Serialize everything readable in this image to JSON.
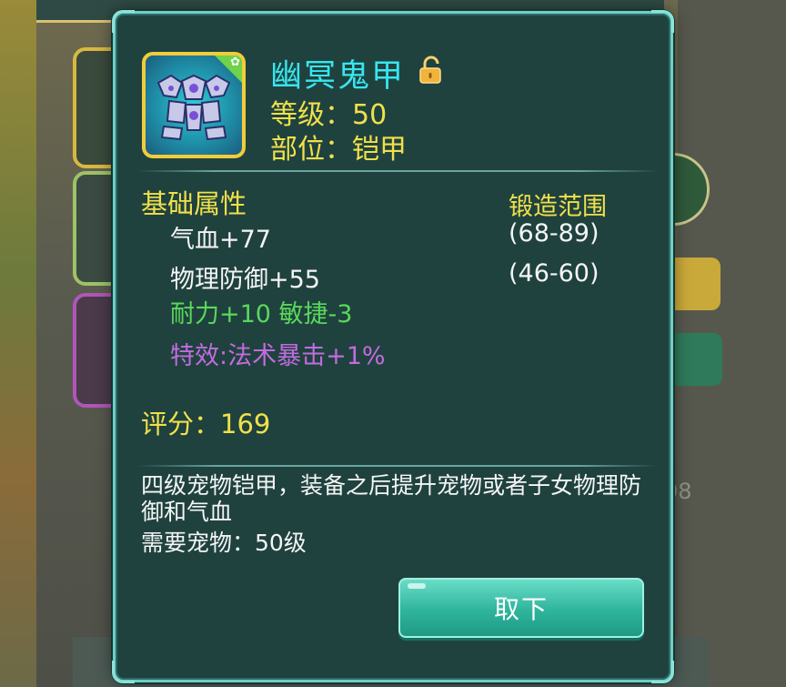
{
  "item": {
    "name": "幽冥鬼甲",
    "level_line": "等级：50",
    "slot_line": "部位：铠甲",
    "icon": "armor-icon",
    "lock_icon": "unlocked-padlock-icon",
    "badge_icon": "paw-icon"
  },
  "attributes": {
    "base_title": "基础属性",
    "forge_title": "锻造范围",
    "rows": [
      {
        "label": "气血+77",
        "range": "(68-89)"
      },
      {
        "label": "物理防御+55",
        "range": "(46-60)"
      }
    ],
    "extra_green": "耐力+10 敏捷-3",
    "special_purple": "特效:法术暴击+1%"
  },
  "score_line": "评分：169",
  "description": "四级宠物铠甲，装备之后提升宠物或者子女物理防御和气血",
  "requirement": "需要宠物：50级",
  "button_label": "取下",
  "background": {
    "number": "08"
  },
  "colors": {
    "name": "#38e6ee",
    "yellow": "#f1e04a",
    "green": "#5ad85a",
    "purple": "#c36bdf",
    "panel": "#1f423f",
    "border": "#6ecfc6"
  }
}
